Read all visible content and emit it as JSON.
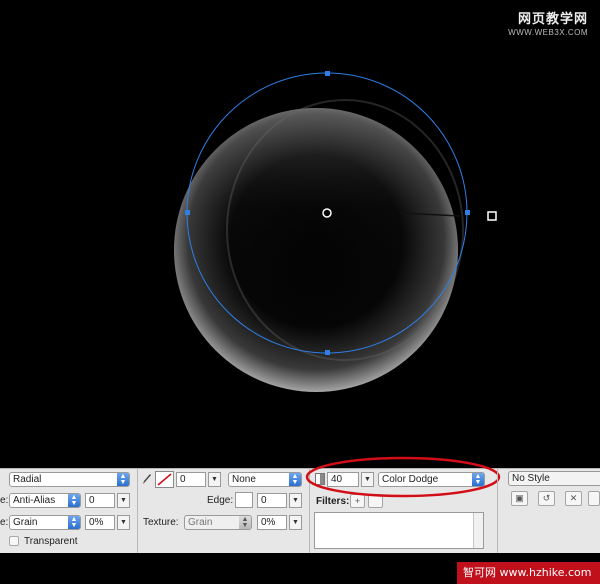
{
  "watermark": {
    "line1": "网页教学网",
    "line2": "WWW.WEB3X.COM"
  },
  "fill_panel": {
    "fill_type": "Radial",
    "edge_label": "e:",
    "edge_mode": "Anti-Alias",
    "edge_value": "0",
    "texture_label": "e:",
    "texture": "Grain",
    "texture_pct": "0%",
    "transparent_label": "Transparent"
  },
  "stroke_panel": {
    "stroke_size": "0",
    "stroke_type": "None",
    "edge_label": "Edge:",
    "edge_value": "0",
    "texture_label": "Texture:",
    "texture": "Grain",
    "texture_pct": "0%"
  },
  "effects_panel": {
    "opacity": "40",
    "blend_mode": "Color Dodge",
    "filters_label": "Filters:"
  },
  "style_panel": {
    "style": "No Style"
  },
  "brand": {
    "text": "智可网 www.hzhike.com"
  },
  "colors": {
    "highlight_ellipse": "#d20d18",
    "path_stroke": "#2f7fe6"
  }
}
